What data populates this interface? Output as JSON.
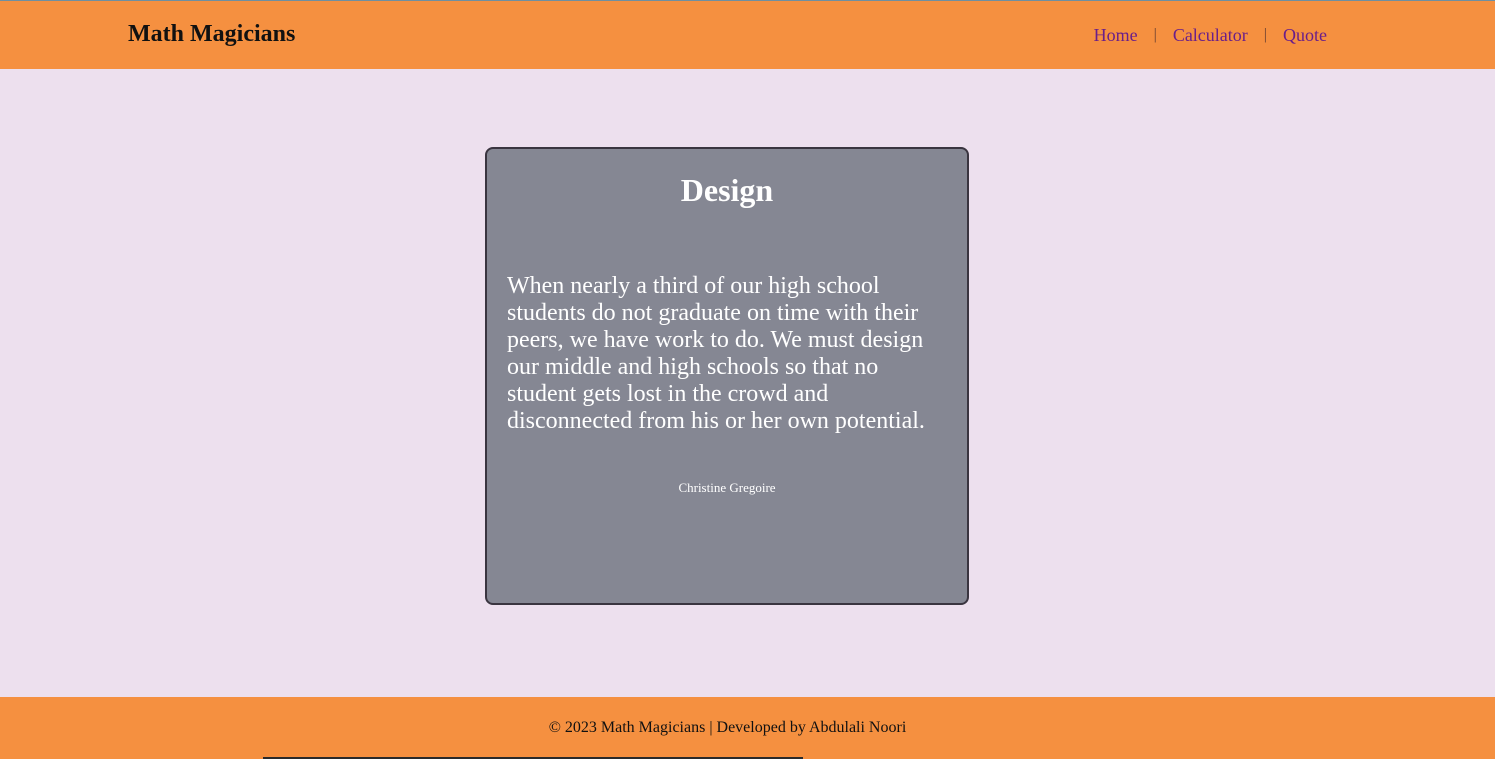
{
  "header": {
    "brand": "Math Magicians",
    "nav": {
      "home": "Home",
      "separator": "|",
      "calculator": "Calculator",
      "quote": "Quote"
    }
  },
  "card": {
    "title": "Design",
    "quote": "When nearly a third of our high school students do not graduate on time with their peers, we have work to do. We must design our middle and high schools so that no student gets lost in the crowd and disconnected from his or her own potential.",
    "author": "Christine Gregoire"
  },
  "footer": {
    "text": "© 2023 Math Magicians | Developed by Abdulali Noori"
  },
  "colors": {
    "header_bg": "#f59040",
    "page_bg": "#ede0ee",
    "card_bg": "#858793",
    "nav_link": "#6a1e8a"
  }
}
